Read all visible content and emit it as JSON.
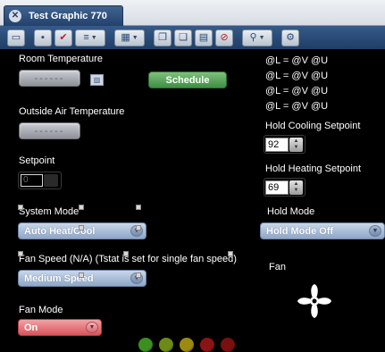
{
  "window": {
    "tab_title": "Test Graphic 770",
    "close_glyph": "✕"
  },
  "toolbar": {
    "icons": [
      "monitor-icon",
      "save-icon",
      "checkmark-icon",
      "list-icon",
      "grid-icon",
      "copy-icon",
      "paste-icon",
      "delete-icon",
      "zoom-icon",
      "settings-icon"
    ]
  },
  "room_temperature": {
    "label": "Room Temperature",
    "value": "------"
  },
  "schedule_button": {
    "label": "Schedule"
  },
  "outside_air": {
    "label": "Outside Air Temperature",
    "value": "------"
  },
  "setpoint": {
    "label": "Setpoint",
    "value": "0"
  },
  "system_mode": {
    "label": "System Mode",
    "value": "Auto Heat/Cool"
  },
  "fan_speed": {
    "label": "Fan Speed (N/A) (Tstat is set for single fan speed)",
    "value": "Medium Speed"
  },
  "fan_mode": {
    "label": "Fan Mode",
    "value": "On"
  },
  "variables": [
    "@L = @V @U",
    "@L = @V @U",
    "@L = @V @U",
    "@L = @V @U"
  ],
  "hold_cooling": {
    "label": "Hold Cooling Setpoint",
    "value": "92"
  },
  "hold_heating": {
    "label": "Hold Heating Setpoint",
    "value": "69"
  },
  "hold_mode": {
    "label": "Hold Mode",
    "value": "Hold Mode Off"
  },
  "fan": {
    "label": "Fan"
  },
  "leds": [
    "#3b8f1f",
    "#6d8a16",
    "#9b8a10",
    "#8a1414",
    "#7a0f0f"
  ]
}
